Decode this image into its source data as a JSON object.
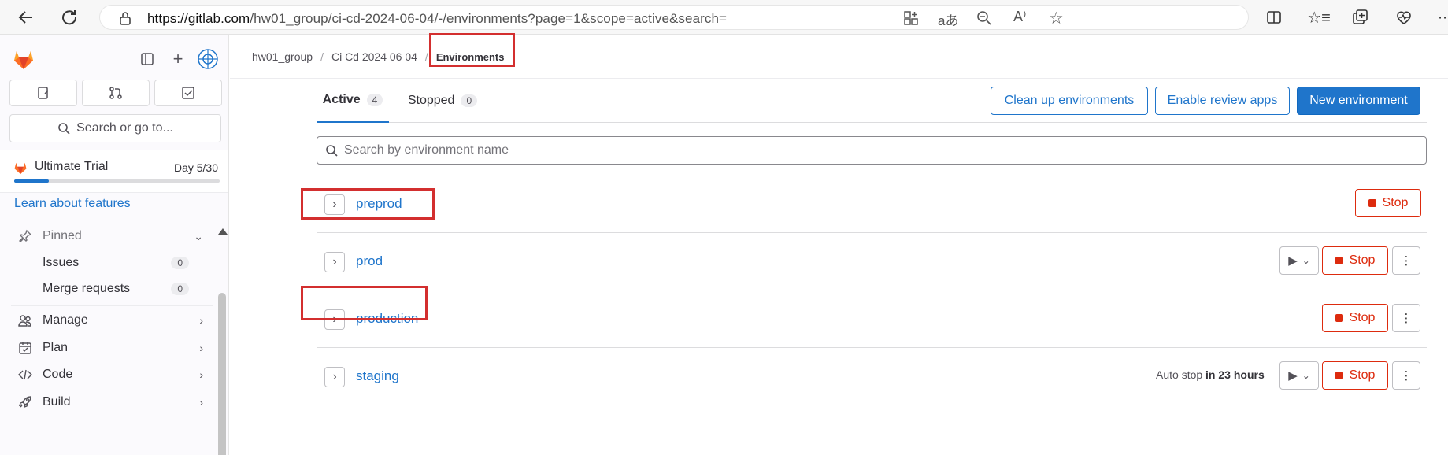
{
  "browser": {
    "url_domain": "https://gitlab.com",
    "url_path": "/hw01_group/ci-cd-2024-06-04/-/environments?page=1&scope=active&search="
  },
  "sidebar": {
    "search_label": "Search or go to...",
    "trial_title": "Ultimate Trial",
    "trial_day": "Day 5/30",
    "trial_progress": 0.167,
    "learn_link": "Learn about features",
    "pinned_label": "Pinned",
    "pinned_items": [
      {
        "label": "Issues",
        "count": "0"
      },
      {
        "label": "Merge requests",
        "count": "0"
      }
    ],
    "sections": [
      {
        "label": "Manage",
        "icon": "users-icon"
      },
      {
        "label": "Plan",
        "icon": "calendar-icon"
      },
      {
        "label": "Code",
        "icon": "code-icon"
      },
      {
        "label": "Build",
        "icon": "rocket-icon"
      }
    ]
  },
  "breadcrumb": {
    "group": "hw01_group",
    "project": "Ci Cd 2024 06 04",
    "current": "Environments"
  },
  "tabs": [
    {
      "label": "Active",
      "count": "4"
    },
    {
      "label": "Stopped",
      "count": "0"
    }
  ],
  "actions": {
    "cleanup": "Clean up environments",
    "review_apps": "Enable review apps",
    "new_env": "New environment"
  },
  "search": {
    "placeholder": "Search by environment name"
  },
  "environments": [
    {
      "name": "preprod",
      "stop_label": "Stop"
    },
    {
      "name": "prod",
      "stop_label": "Stop"
    },
    {
      "name": "production",
      "stop_label": "Stop"
    },
    {
      "name": "staging",
      "stop_label": "Stop",
      "auto_stop_prefix": "Auto stop",
      "auto_stop_time": "in 23 hours"
    }
  ],
  "colors": {
    "accent": "#1f75cb",
    "danger": "#dd2b0e",
    "highlight": "#d32f2f"
  }
}
